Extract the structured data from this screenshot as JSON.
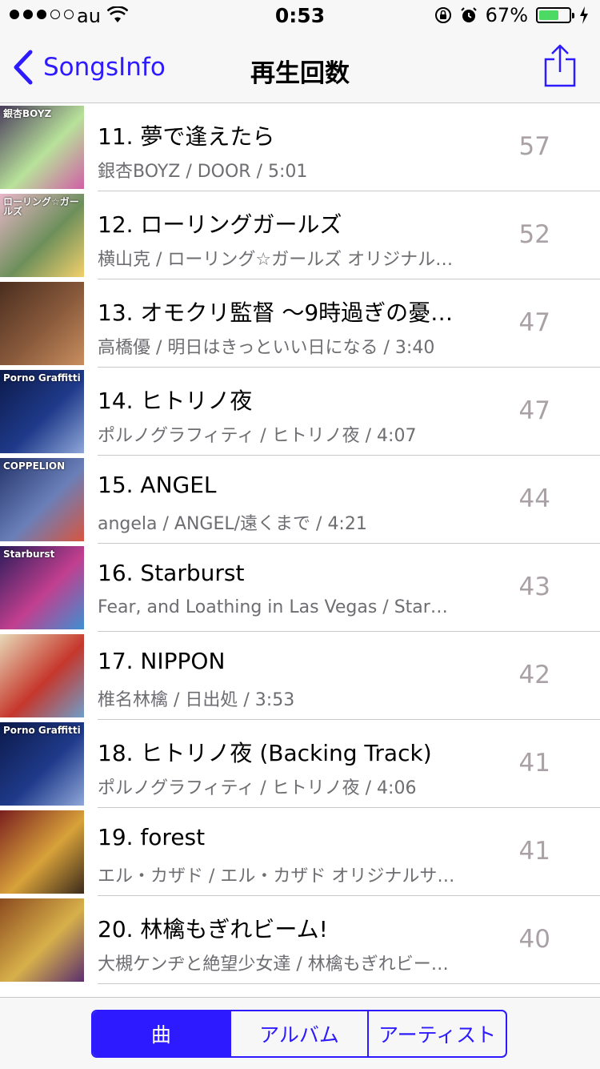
{
  "status_bar": {
    "carrier": "au",
    "time": "0:53",
    "battery_percent_text": "67%",
    "battery_level": 0.67
  },
  "nav": {
    "back_label": "SongsInfo",
    "title": "再生回数"
  },
  "songs": [
    {
      "title": "11. 夢で逢えたら",
      "subtitle": "銀杏BOYZ / DOOR / 5:01",
      "count": "57",
      "art_text": "銀杏BOYZ",
      "art_colors": [
        "#4a3d5c",
        "#b8e29a",
        "#d15fa6"
      ]
    },
    {
      "title": "12. ローリングガールズ",
      "subtitle": "横山克 / ローリング☆ガールズ オリジナル…",
      "count": "52",
      "art_text": "ローリング☆ガールズ",
      "art_colors": [
        "#e9b7c9",
        "#6d8f5b",
        "#f3d06b"
      ]
    },
    {
      "title": "13. オモクリ監督 〜9時過ぎの憂…",
      "subtitle": "高橋優 / 明日はきっといい日になる / 3:40",
      "count": "47",
      "art_text": "",
      "art_colors": [
        "#4a2e1f",
        "#8a5b3c",
        "#c98e5f"
      ]
    },
    {
      "title": "14. ヒトリノ夜",
      "subtitle": "ポルノグラフィティ / ヒトリノ夜 / 4:07",
      "count": "47",
      "art_text": "Porno Graffitti",
      "art_colors": [
        "#0c1a4a",
        "#1f3a8a",
        "#8fa7d9"
      ]
    },
    {
      "title": "15. ANGEL",
      "subtitle": "angela / ANGEL/遠くまで / 4:21",
      "count": "44",
      "art_text": "COPPELION",
      "art_colors": [
        "#24346b",
        "#6a7fb8",
        "#d8553f"
      ]
    },
    {
      "title": "16. Starburst",
      "subtitle": "Fear, and Loathing in Las Vegas / Star…",
      "count": "43",
      "art_text": "Starburst",
      "art_colors": [
        "#2b1c5a",
        "#c23f8f",
        "#3e8fd1"
      ]
    },
    {
      "title": "17. NIPPON",
      "subtitle": "椎名林檎 / 日出処 / 3:53",
      "count": "42",
      "art_text": "",
      "art_colors": [
        "#e7d9b8",
        "#c6372c",
        "#6f9ec9"
      ]
    },
    {
      "title": "18. ヒトリノ夜 (Backing Track)",
      "subtitle": "ポルノグラフィティ / ヒトリノ夜 / 4:06",
      "count": "41",
      "art_text": "Porno Graffitti",
      "art_colors": [
        "#0c1a4a",
        "#1f3a8a",
        "#8fa7d9"
      ]
    },
    {
      "title": "19. forest",
      "subtitle": "エル・カザド / エル・カザド オリジナルサ…",
      "count": "41",
      "art_text": "",
      "art_colors": [
        "#7a1f1f",
        "#d8a23a",
        "#3b2a1c"
      ]
    },
    {
      "title": "20. 林檎もぎれビーム!",
      "subtitle": "大槻ケンヂと絶望少女達 / 林檎もぎれビー…",
      "count": "40",
      "art_text": "",
      "art_colors": [
        "#8c4b1f",
        "#d7b04a",
        "#5b2f6e"
      ]
    }
  ],
  "segments": [
    {
      "label": "曲",
      "active": true
    },
    {
      "label": "アルバム",
      "active": false
    },
    {
      "label": "アーティスト",
      "active": false
    }
  ],
  "colors": {
    "accent": "#2d1aff",
    "count_text": "#a9a1a6",
    "battery_fill": "#4cd964"
  }
}
